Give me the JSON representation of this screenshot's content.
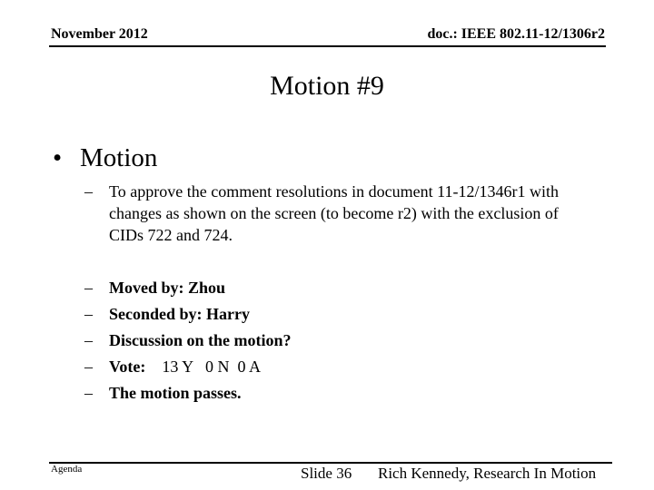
{
  "header": {
    "date": "November 2012",
    "doc_id": "doc.: IEEE 802.11-12/1306r2"
  },
  "title": "Motion #9",
  "bullet": {
    "symbol": "•",
    "label": "Motion"
  },
  "sub_bullet": {
    "dash": "–",
    "text": "To approve the comment resolutions in document 11-12/1346r1 with changes as shown on the screen (to become r2) with the exclusion of CIDs 722 and 724."
  },
  "procedure": {
    "dash": "–",
    "items": [
      {
        "label": "Moved by: Zhou"
      },
      {
        "label": "Seconded by: Harry"
      },
      {
        "label": "Discussion on the motion?"
      },
      {
        "label": "Vote:",
        "detail": "13 Y   0 N  0 A"
      },
      {
        "label": "The motion passes."
      }
    ]
  },
  "footer": {
    "left": "Agenda",
    "slide": "Slide 36",
    "author": "Rich Kennedy, Research In Motion"
  }
}
